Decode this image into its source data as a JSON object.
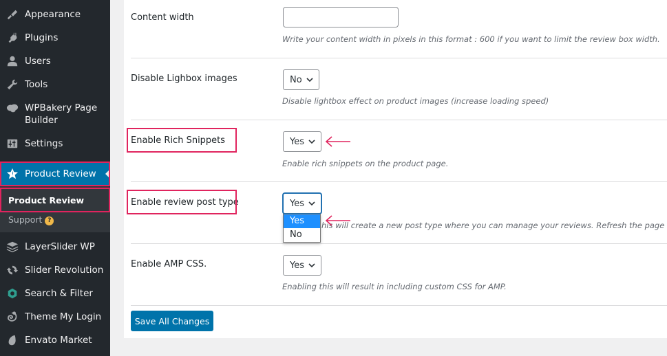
{
  "sidebar": {
    "items": [
      {
        "label": "Appearance",
        "icon": "paintbrush-icon"
      },
      {
        "label": "Plugins",
        "icon": "plug-icon"
      },
      {
        "label": "Users",
        "icon": "user-icon"
      },
      {
        "label": "Tools",
        "icon": "wrench-icon"
      },
      {
        "label": "WPBakery Page Builder",
        "icon": "cloud-icon"
      },
      {
        "label": "Settings",
        "icon": "sliders-icon"
      },
      {
        "label": "Product Review",
        "icon": "star-icon",
        "active": true
      },
      {
        "label": "LayerSlider WP",
        "icon": "layers-icon"
      },
      {
        "label": "Slider Revolution",
        "icon": "refresh-icon"
      },
      {
        "label": "Search & Filter",
        "icon": "search-filter-icon"
      },
      {
        "label": "Theme My Login",
        "icon": "chameleon-icon"
      },
      {
        "label": "Envato Market",
        "icon": "leaf-icon"
      }
    ],
    "submenu": [
      {
        "label": "Product Review",
        "current": true
      },
      {
        "label": "Support",
        "badge": "?"
      }
    ]
  },
  "settings": {
    "content_width": {
      "label": "Content width",
      "value": "",
      "description": "Write your content width in pixels in this format : 600 if you want to limit the review box width."
    },
    "disable_lightbox": {
      "label": "Disable Lighbox images",
      "value": "No",
      "description": "Disable lightbox effect on product images (increase loading speed)"
    },
    "rich_snippets": {
      "label": "Enable Rich Snippets",
      "value": "Yes",
      "description": "Enable rich snippets on the product page."
    },
    "review_post_type": {
      "label": "Enable review post type",
      "value": "Yes",
      "description": "Enabling this will create a new post type where you can manage your reviews. Refresh the page on saving changes.",
      "visible_description": "his will create a new post type where you can manage your reviews. Refresh the page on saving ch",
      "dropdown_open": true,
      "options": [
        "Yes",
        "No"
      ]
    },
    "amp_css": {
      "label": "Enable AMP CSS.",
      "value": "Yes",
      "description": "Enabling this will result in including custom CSS for AMP."
    }
  },
  "actions": {
    "save_label": "Save All Changes"
  },
  "colors": {
    "accent": "#0073aa",
    "annotation": "#e0245e",
    "sidebar_bg": "#23282d",
    "selected_option": "#1e90ff"
  }
}
